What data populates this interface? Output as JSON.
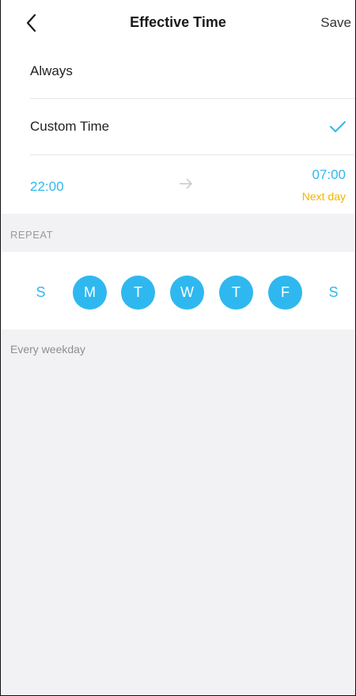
{
  "header": {
    "title": "Effective Time",
    "save_label": "Save"
  },
  "options": {
    "always_label": "Always",
    "custom_label": "Custom Time",
    "selected": "custom"
  },
  "time_range": {
    "start": "22:00",
    "end": "07:00",
    "end_note": "Next day"
  },
  "repeat": {
    "section_label": "REPEAT",
    "days": [
      {
        "label": "S",
        "selected": false
      },
      {
        "label": "M",
        "selected": true
      },
      {
        "label": "T",
        "selected": true
      },
      {
        "label": "W",
        "selected": true
      },
      {
        "label": "T",
        "selected": true
      },
      {
        "label": "F",
        "selected": true
      },
      {
        "label": "S",
        "selected": false
      }
    ],
    "summary": "Every weekday"
  },
  "colors": {
    "accent": "#2fb8ef",
    "note": "#f5b400",
    "marker": "#d0021b"
  }
}
